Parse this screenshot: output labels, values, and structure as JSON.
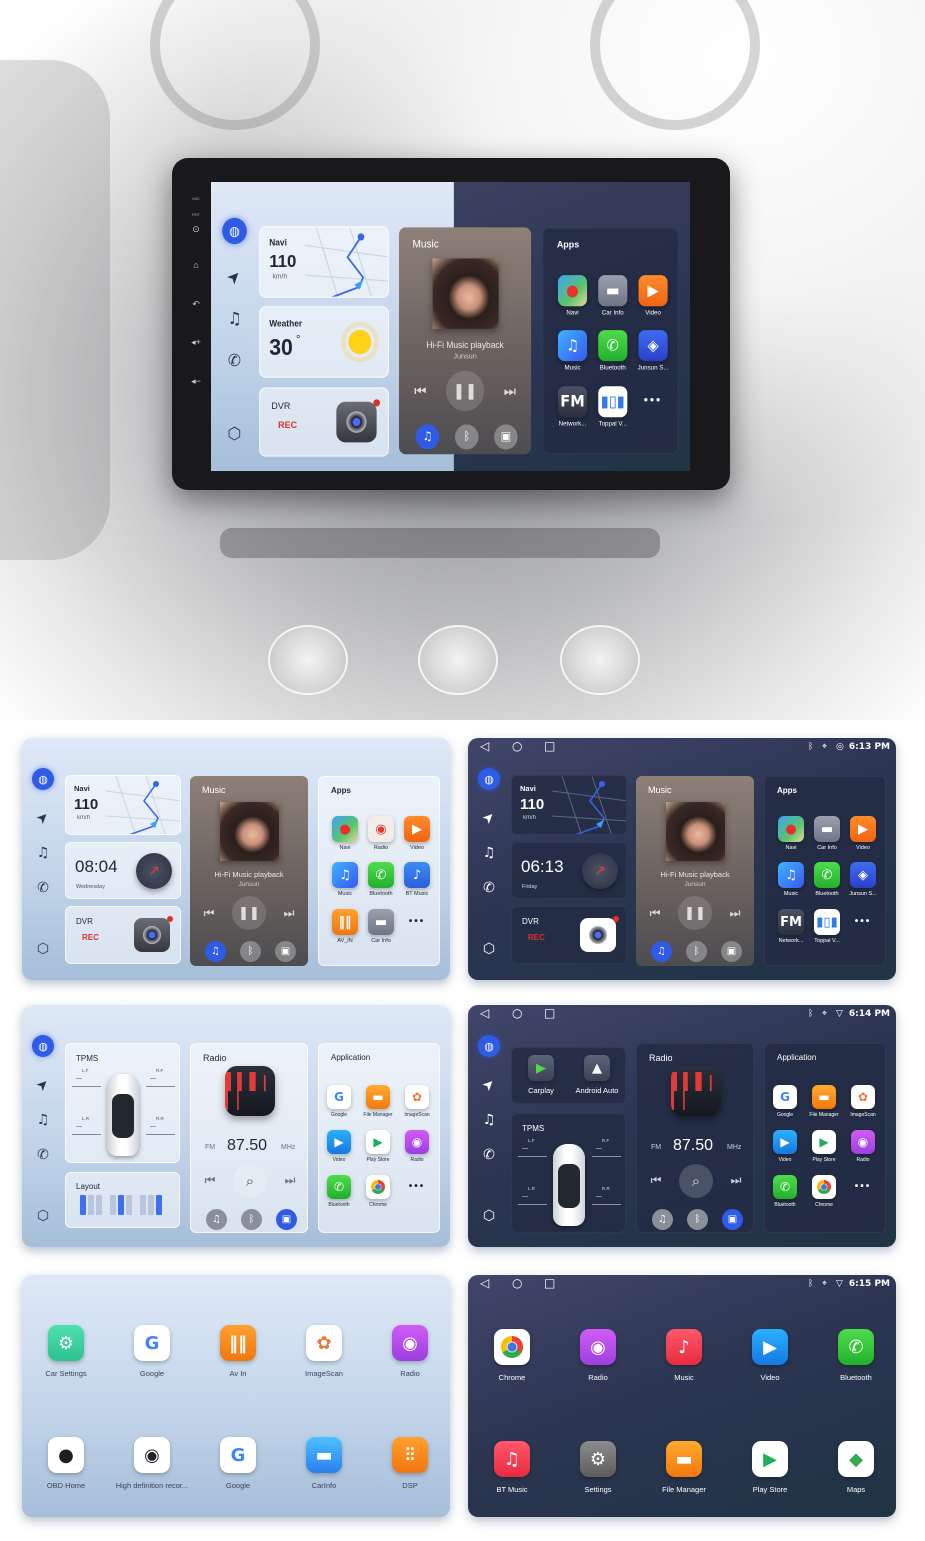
{
  "head_unit": {
    "bezel_labels": [
      "MIC",
      "RST"
    ]
  },
  "screens": [
    {
      "layout": "home-music",
      "theme": "split",
      "navi": {
        "title": "Navi",
        "speed": "110",
        "unit": "km/h"
      },
      "weather": {
        "title": "Weather",
        "temp": "30",
        "unit": "°"
      },
      "dvr": {
        "title": "DVR",
        "status": "REC"
      },
      "music": {
        "title": "Music",
        "track": "Hi-Fi Music playback",
        "artist": "Junsun"
      },
      "apps": {
        "title": "Apps",
        "items": [
          {
            "label": "Navi",
            "icon": "navi"
          },
          {
            "label": "Car Info",
            "icon": "carinfo"
          },
          {
            "label": "Video",
            "icon": "video-orange"
          },
          {
            "label": "Music",
            "icon": "music-blue"
          },
          {
            "label": "Bluetooth",
            "icon": "phone-green"
          },
          {
            "label": "Junsun S...",
            "icon": "junsun"
          },
          {
            "label": "Network...",
            "icon": "fm"
          },
          {
            "label": "Toppal V...",
            "icon": "toppal"
          },
          {
            "label": "",
            "icon": "more"
          }
        ]
      }
    },
    {
      "layout": "home-music",
      "theme": "light",
      "navi": {
        "title": "Navi",
        "speed": "110",
        "unit": "km/h"
      },
      "clock": {
        "time": "08:04",
        "day": "Wednesday"
      },
      "dvr": {
        "title": "DVR",
        "status": "REC"
      },
      "music": {
        "title": "Music",
        "track": "Hi-Fi Music playback",
        "artist": "Junsun"
      },
      "apps": {
        "title": "Apps",
        "items": [
          {
            "label": "Navi",
            "icon": "navi"
          },
          {
            "label": "Radio",
            "icon": "radio-red"
          },
          {
            "label": "Video",
            "icon": "video-orange"
          },
          {
            "label": "Music",
            "icon": "music-blue"
          },
          {
            "label": "Bluetooth",
            "icon": "phone-green"
          },
          {
            "label": "BT Music",
            "icon": "btmusic-blue"
          },
          {
            "label": "AV_IN",
            "icon": "avin"
          },
          {
            "label": "Car Info",
            "icon": "carinfo"
          },
          {
            "label": "",
            "icon": "more"
          }
        ]
      }
    },
    {
      "layout": "home-music",
      "theme": "dark",
      "status": {
        "time": "6:13 PM",
        "icons": [
          "bluetooth-icon",
          "location-icon",
          "hotspot-icon"
        ]
      },
      "navi": {
        "title": "Navi",
        "speed": "110",
        "unit": "km/h"
      },
      "clock": {
        "time": "06:13",
        "day": "Friday"
      },
      "dvr": {
        "title": "DVR",
        "status": "REC"
      },
      "music": {
        "title": "Music",
        "track": "Hi-Fi Music playback",
        "artist": "Junsun"
      },
      "apps": {
        "title": "Apps",
        "items": [
          {
            "label": "Navi",
            "icon": "navi"
          },
          {
            "label": "Car Info",
            "icon": "carinfo"
          },
          {
            "label": "Video",
            "icon": "video-orange"
          },
          {
            "label": "Music",
            "icon": "music-blue"
          },
          {
            "label": "Bluetooth",
            "icon": "phone-green"
          },
          {
            "label": "Junsun S...",
            "icon": "junsun"
          },
          {
            "label": "Network...",
            "icon": "fm"
          },
          {
            "label": "Toppal V...",
            "icon": "toppal"
          },
          {
            "label": "",
            "icon": "more"
          }
        ]
      }
    },
    {
      "layout": "home-radio",
      "theme": "light",
      "tpms": {
        "title": "TPMS",
        "wheels": [
          {
            "pos": "L.F",
            "value": "---"
          },
          {
            "pos": "R.F",
            "value": "---"
          },
          {
            "pos": "L.R",
            "value": "---"
          },
          {
            "pos": "R.R",
            "value": "---"
          }
        ]
      },
      "layout_card": {
        "title": "Layout"
      },
      "radio": {
        "title": "Radio",
        "band": "FM",
        "freq": "87.50",
        "unit": "MHz"
      },
      "application": {
        "title": "Application",
        "items": [
          {
            "label": "Google",
            "icon": "google"
          },
          {
            "label": "File Manager",
            "icon": "files"
          },
          {
            "label": "ImageScan",
            "icon": "imagescan"
          },
          {
            "label": "Video",
            "icon": "video-blue"
          },
          {
            "label": "Play Store",
            "icon": "playstore"
          },
          {
            "label": "Radio",
            "icon": "radio-purple"
          },
          {
            "label": "Bluetooth",
            "icon": "phone-green"
          },
          {
            "label": "Chrome",
            "icon": "chrome"
          },
          {
            "label": "",
            "icon": "more"
          }
        ]
      }
    },
    {
      "layout": "home-radio",
      "theme": "dark",
      "status": {
        "time": "6:14 PM",
        "icons": [
          "bluetooth-icon",
          "location-icon",
          "wifi-icon"
        ]
      },
      "projection": [
        {
          "label": "Carplay",
          "icon": "carplay"
        },
        {
          "label": "Android Auto",
          "icon": "androidauto"
        }
      ],
      "tpms": {
        "title": "TPMS",
        "wheels": [
          {
            "pos": "L.F",
            "value": "---"
          },
          {
            "pos": "R.F",
            "value": "---"
          },
          {
            "pos": "L.R",
            "value": "---"
          },
          {
            "pos": "R.R",
            "value": "---"
          }
        ]
      },
      "radio": {
        "title": "Radio",
        "band": "FM",
        "freq": "87.50",
        "unit": "MHz"
      },
      "application": {
        "title": "Application",
        "items": [
          {
            "label": "Google",
            "icon": "google"
          },
          {
            "label": "File Manager",
            "icon": "files"
          },
          {
            "label": "ImageScan",
            "icon": "imagescan"
          },
          {
            "label": "Video",
            "icon": "video-blue"
          },
          {
            "label": "Play Store",
            "icon": "playstore"
          },
          {
            "label": "Radio",
            "icon": "radio-purple"
          },
          {
            "label": "Bluetooth",
            "icon": "phone-green"
          },
          {
            "label": "Chrome",
            "icon": "chrome"
          },
          {
            "label": "",
            "icon": "more"
          }
        ]
      }
    },
    {
      "layout": "drawer",
      "theme": "light",
      "items": [
        {
          "label": "Car Settings",
          "icon": "carsettings"
        },
        {
          "label": "Google",
          "icon": "google"
        },
        {
          "label": "Av In",
          "icon": "avin"
        },
        {
          "label": "ImageScan",
          "icon": "imagescan"
        },
        {
          "label": "Radio",
          "icon": "radio-purple"
        },
        {
          "label": "OBD Home",
          "icon": "obd"
        },
        {
          "label": "High definition recor...",
          "icon": "hdrec"
        },
        {
          "label": "Google",
          "icon": "google"
        },
        {
          "label": "CarInfo",
          "icon": "carinfo-blue"
        },
        {
          "label": "DSP",
          "icon": "dsp"
        }
      ]
    },
    {
      "layout": "drawer",
      "theme": "dark",
      "status": {
        "time": "6:15 PM",
        "icons": [
          "bluetooth-icon",
          "location-icon",
          "wifi-icon"
        ]
      },
      "items": [
        {
          "label": "Chrome",
          "icon": "chrome"
        },
        {
          "label": "Radio",
          "icon": "radio-purple"
        },
        {
          "label": "Music",
          "icon": "music-red"
        },
        {
          "label": "Video",
          "icon": "video-blue"
        },
        {
          "label": "Bluetooth",
          "icon": "phone-green"
        },
        {
          "label": "BT Music",
          "icon": "btmusic-red"
        },
        {
          "label": "Settings",
          "icon": "settings"
        },
        {
          "label": "File Manager",
          "icon": "files"
        },
        {
          "label": "Play Store",
          "icon": "playstore"
        },
        {
          "label": "Maps",
          "icon": "maps"
        }
      ]
    }
  ],
  "colors": {
    "accent": "#2f5be6",
    "rec": "#e0302a",
    "dark_bg": "#2c3552",
    "light_bg": "#c3d5ea"
  }
}
